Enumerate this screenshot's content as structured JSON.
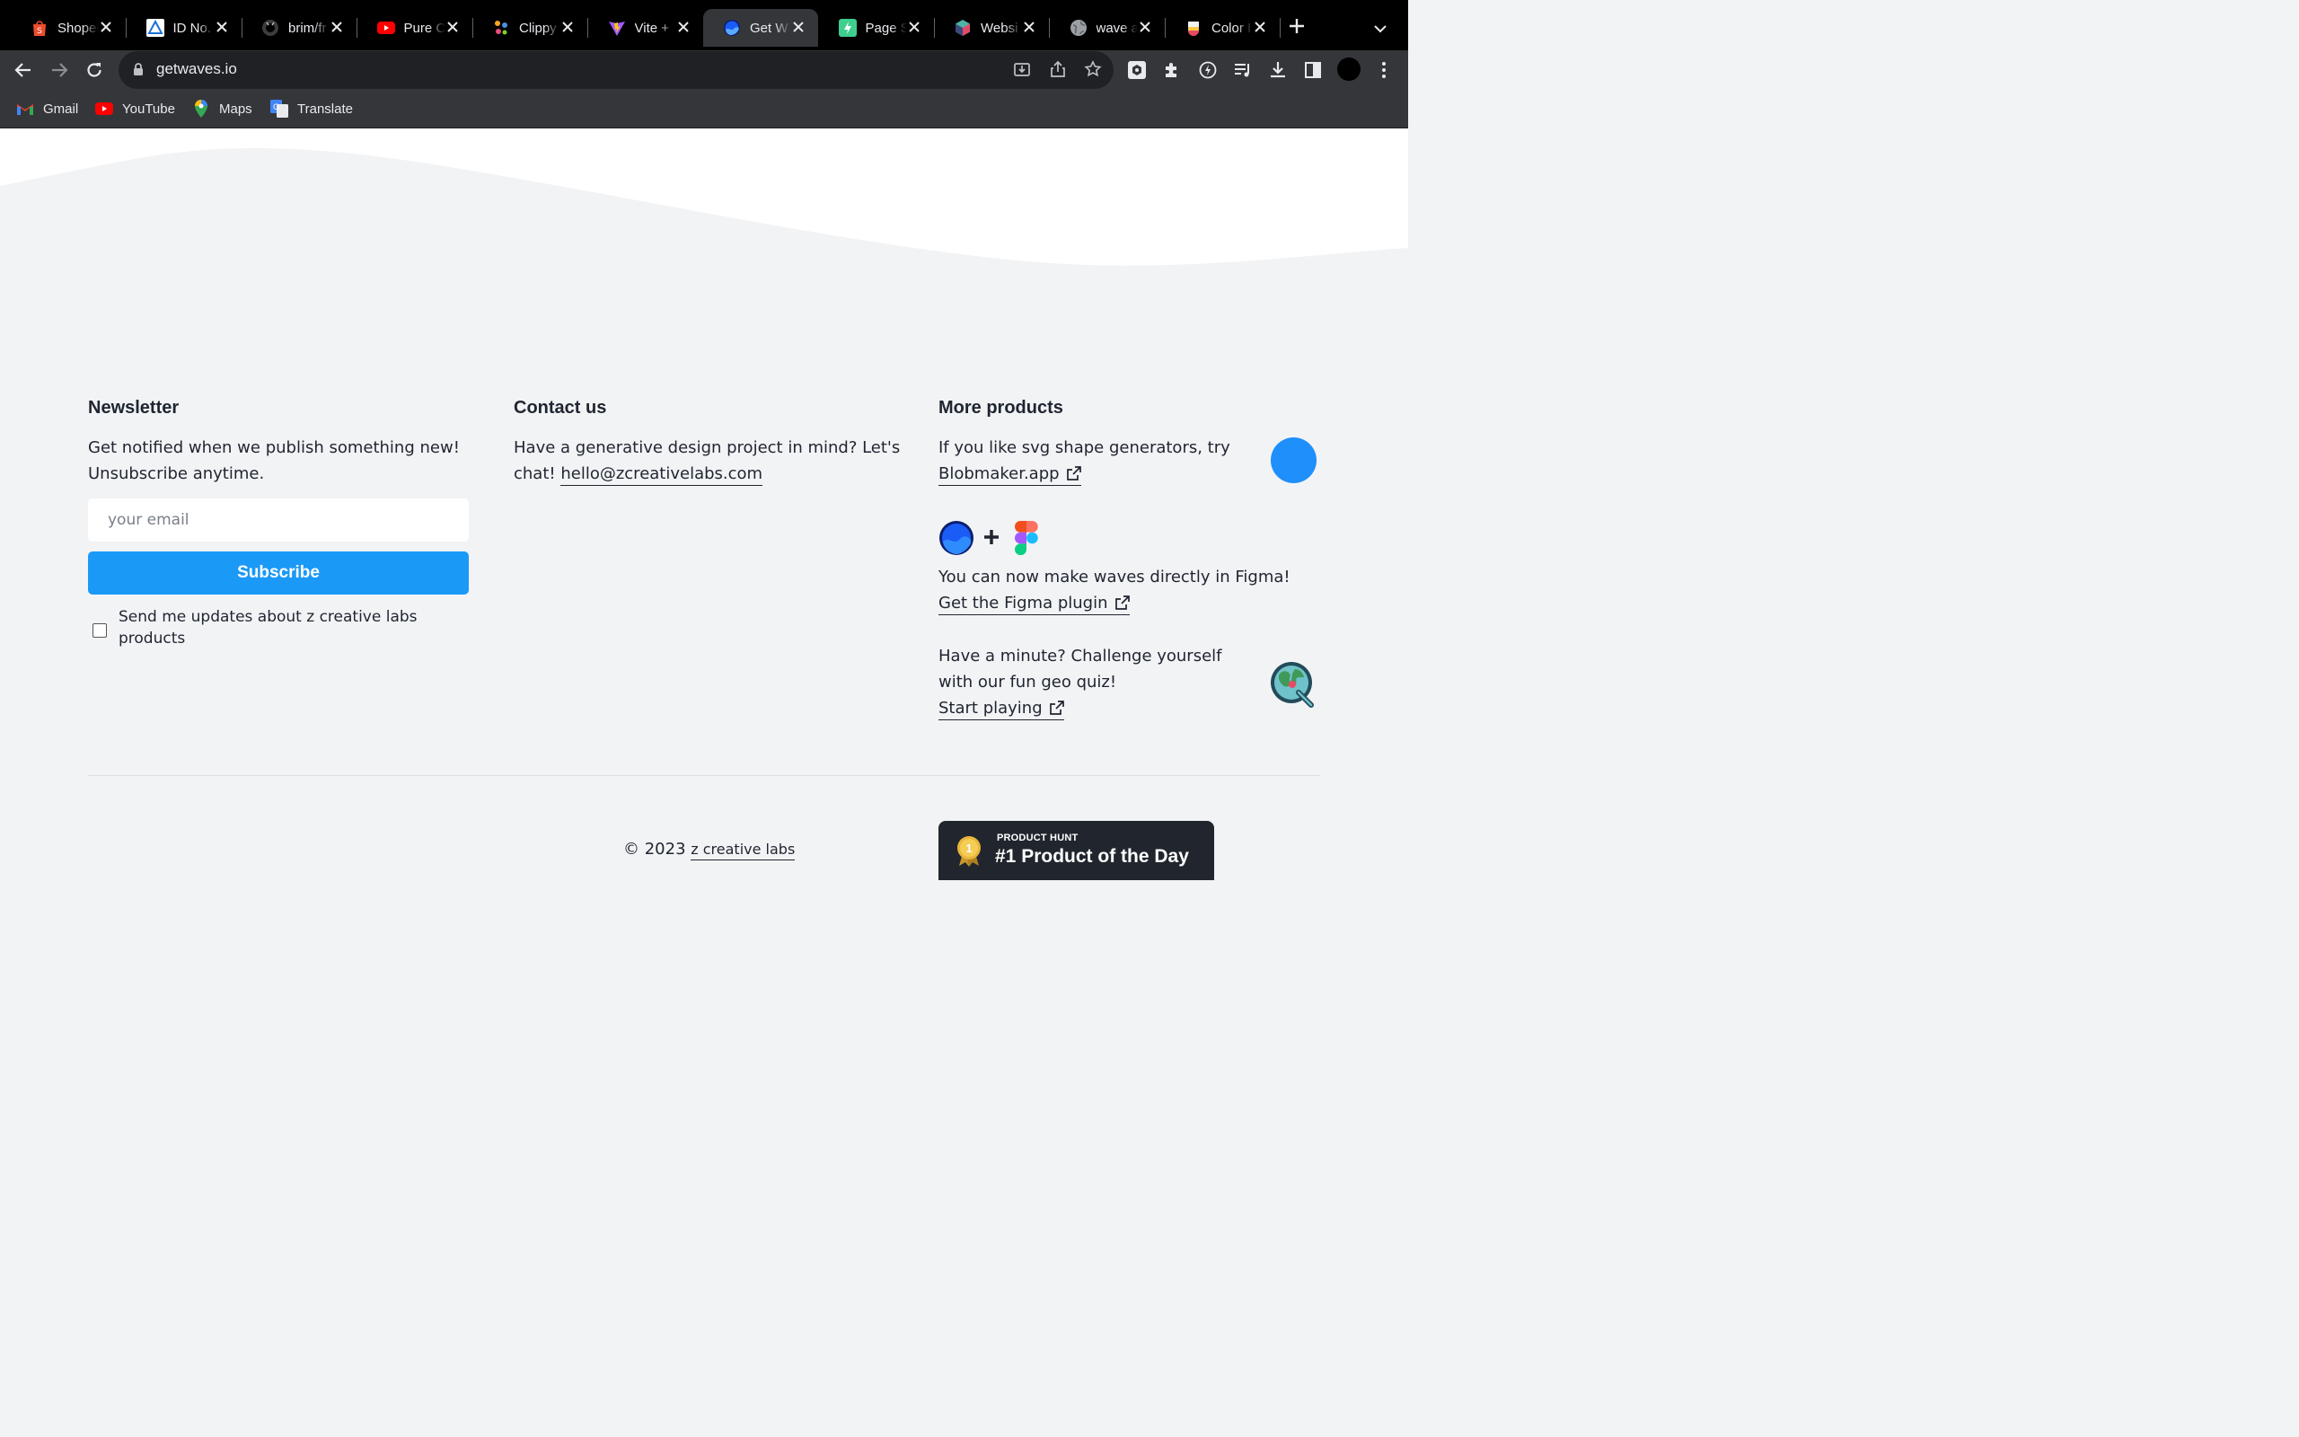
{
  "browser": {
    "tabs": [
      {
        "title": "Shopee",
        "icon": "shopee-icon",
        "color": "#ee4d2d"
      },
      {
        "title": "ID No.",
        "icon": "triangle-logo-icon",
        "color": "#1d6fd8"
      },
      {
        "title": "brim/fr",
        "icon": "github-icon",
        "color": "#ffffff"
      },
      {
        "title": "Pure C",
        "icon": "youtube-icon",
        "color": "#ff0000"
      },
      {
        "title": "Clippy",
        "icon": "clippy-dots-icon",
        "color": "#f5a623"
      },
      {
        "title": "Vite +",
        "icon": "vite-icon",
        "color": "#a259ff"
      },
      {
        "title": "Get W",
        "icon": "getwaves-icon",
        "color": "#1b5cf7",
        "active": true
      },
      {
        "title": "Page S",
        "icon": "pagespeed-icon",
        "color": "#3ecf8e"
      },
      {
        "title": "Websi",
        "icon": "cube-icon",
        "color": "#e24a68"
      },
      {
        "title": "wave a",
        "icon": "globe-icon",
        "color": "#9aa0a6"
      },
      {
        "title": "Color I",
        "icon": "color-drop-icon",
        "color": "#f7c948"
      }
    ],
    "url": "getwaves.io",
    "bookmarks": [
      {
        "label": "Gmail",
        "icon": "gmail-icon"
      },
      {
        "label": "YouTube",
        "icon": "youtube-icon"
      },
      {
        "label": "Maps",
        "icon": "maps-pin-icon"
      },
      {
        "label": "Translate",
        "icon": "translate-icon"
      }
    ]
  },
  "footer": {
    "newsletter": {
      "heading": "Newsletter",
      "text_line1": "Get notified when we publish something new!",
      "text_line2": "Unsubscribe anytime.",
      "email_placeholder": "your email",
      "subscribe_label": "Subscribe",
      "checkbox_label": "Send me updates about z creative labs products",
      "checkbox_checked": false
    },
    "contact": {
      "heading": "Contact us",
      "text_line1": "Have a generative design project in mind? Let's",
      "text_line2_prefix": "chat!",
      "email": "hello@zcreativelabs.com"
    },
    "more_products": {
      "heading": "More products",
      "blob_text": "If you like svg shape generators, try",
      "blob_link": "Blobmaker.app",
      "figma_text": "You can now make waves directly in Figma!",
      "figma_link": "Get the Figma plugin",
      "quiz_text_line1": "Have a minute? Challenge yourself",
      "quiz_text_line2": "with our fun geo quiz!",
      "quiz_link": "Start playing"
    },
    "copyright_prefix": "© 2023",
    "copyright_link": "z creative labs",
    "product_hunt": {
      "small": "PRODUCT HUNT",
      "big": "#1 Product of the Day",
      "medal_number": "1"
    }
  },
  "colors": {
    "accent": "#1b99f7",
    "page_bg": "#f2f3f5",
    "text": "#1f2530",
    "blob": "#1e8ffb"
  }
}
